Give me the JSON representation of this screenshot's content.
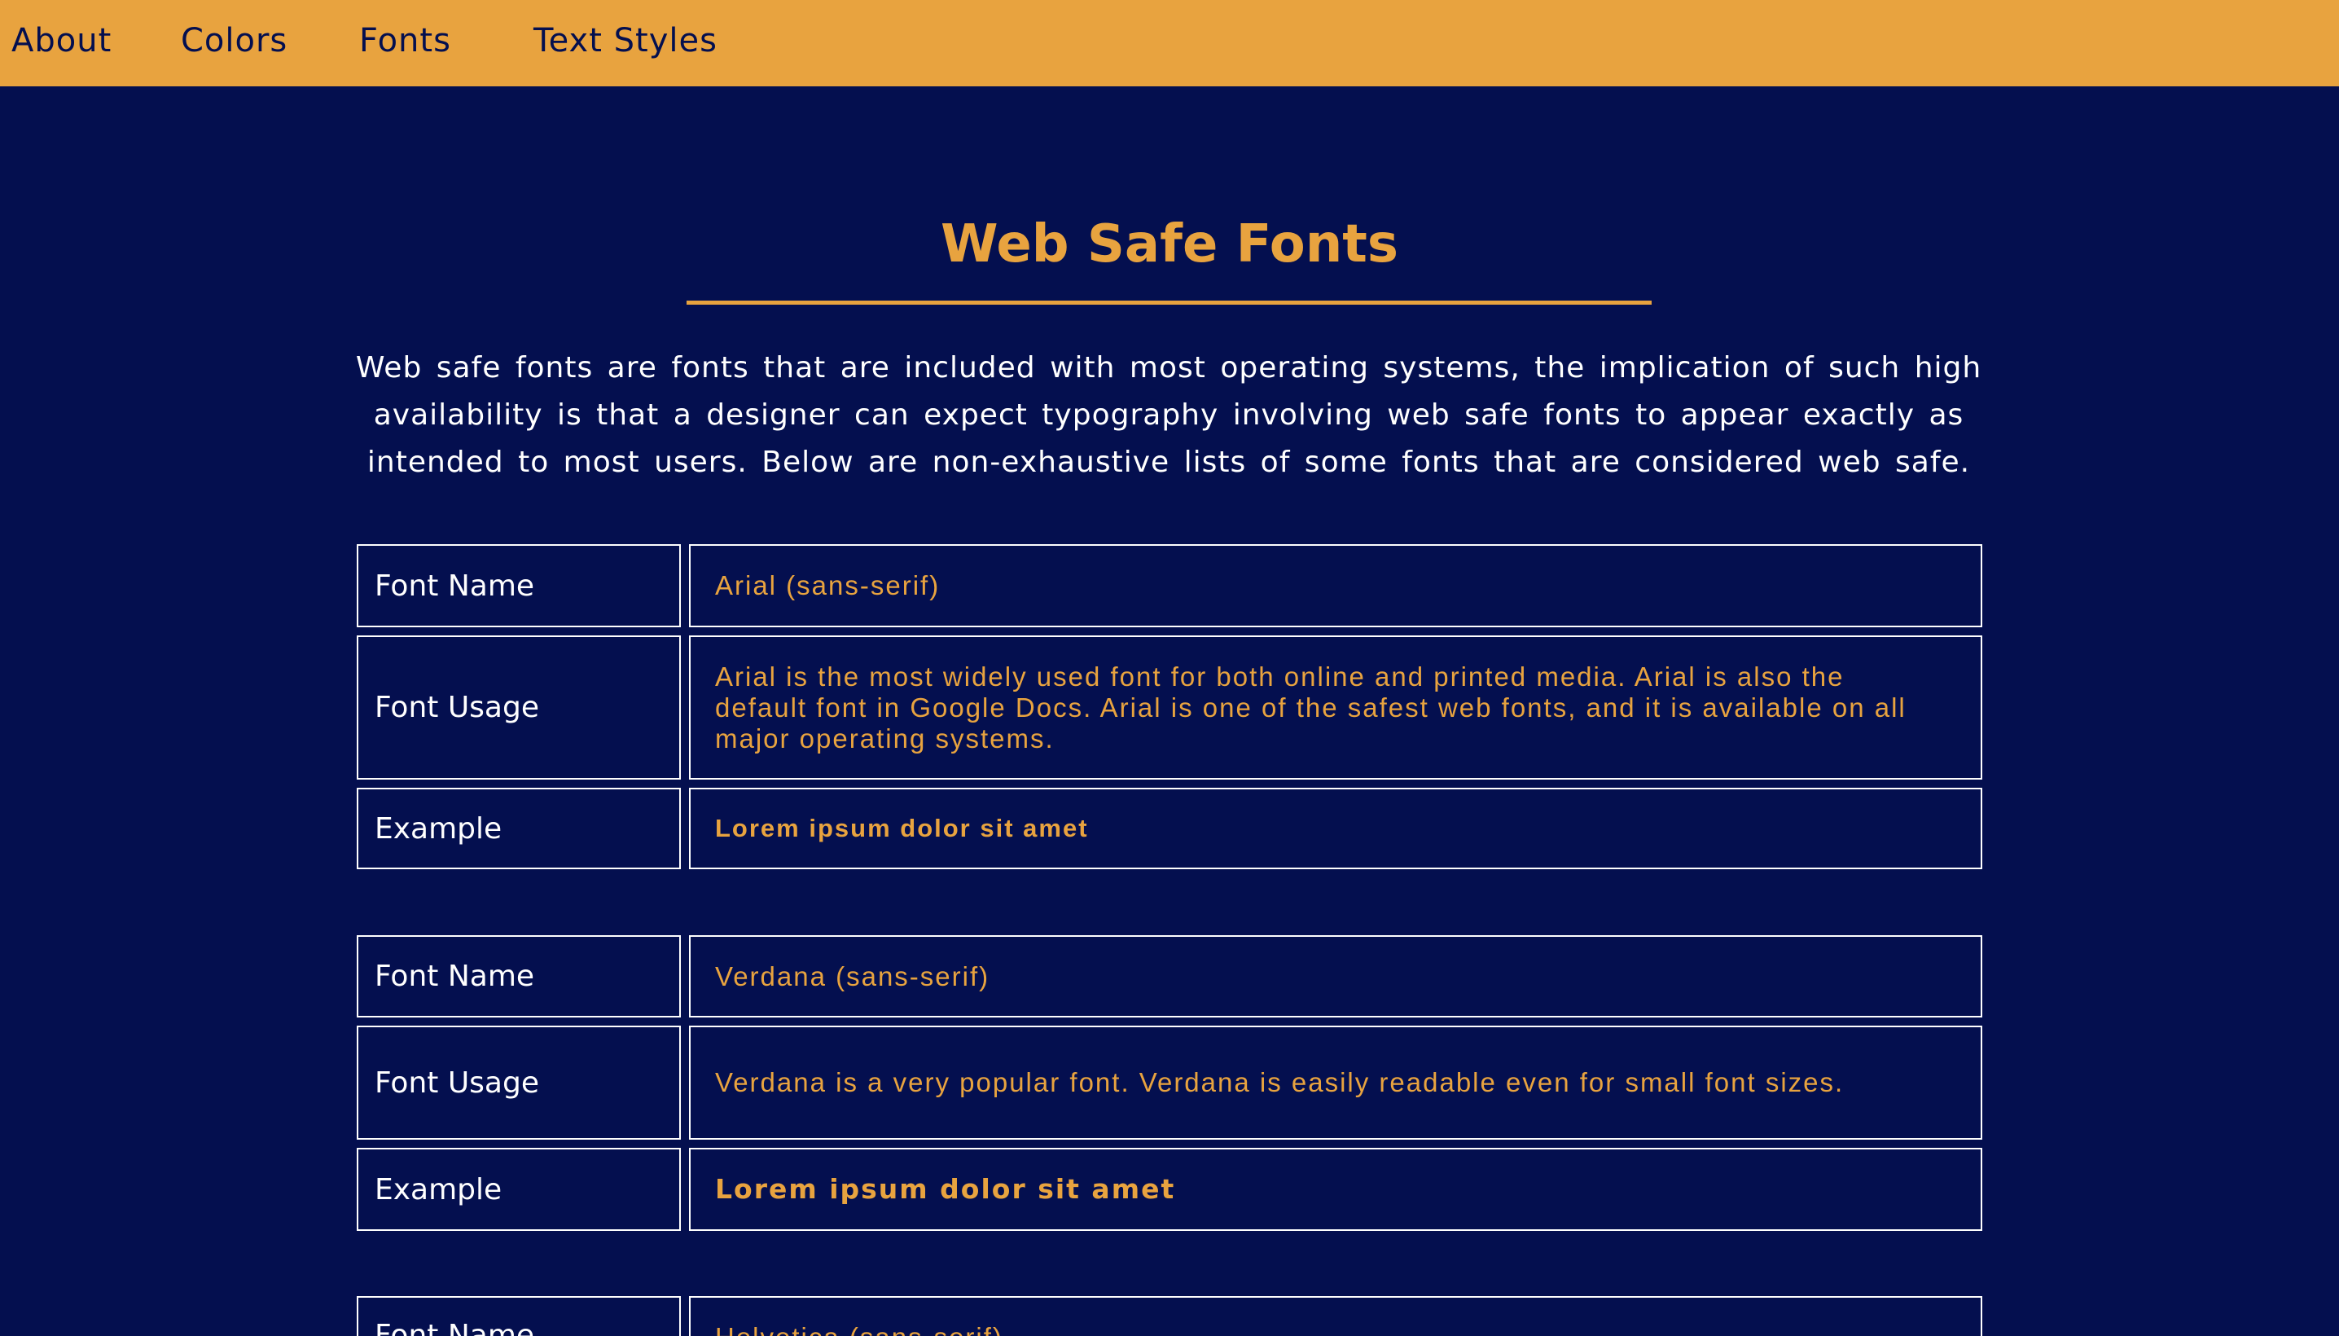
{
  "nav": {
    "items": [
      {
        "label": "About"
      },
      {
        "label": "Colors"
      },
      {
        "label": "Fonts"
      },
      {
        "label": "Text Styles"
      }
    ]
  },
  "main": {
    "title": "Web Safe Fonts",
    "intro": "Web safe fonts are fonts that are included with most operating systems, the implication of such high availability is that a designer can expect typography involving web safe fonts to appear exactly as intended to most users. Below are non-exhaustive lists of some fonts that are considered web safe."
  },
  "labels": {
    "font_name": "Font Name",
    "font_usage": "Font Usage",
    "example": "Example"
  },
  "fonts": [
    {
      "name": "Arial (sans-serif)",
      "usage": "Arial is the most widely used font for both online and printed media. Arial is also the default font in Google Docs. Arial is one of the safest web fonts, and it is available on all major operating systems.",
      "example": "Lorem ipsum dolor sit amet"
    },
    {
      "name": "Verdana (sans-serif)",
      "usage": "Verdana is a very popular font. Verdana is easily readable even for small font sizes.",
      "example": "Lorem ipsum dolor sit amet"
    },
    {
      "name": "Helvetica (sans-serif)"
    }
  ],
  "colors": {
    "background": "#040f4f",
    "accent": "#e8a33f",
    "text": "#ffffff"
  }
}
